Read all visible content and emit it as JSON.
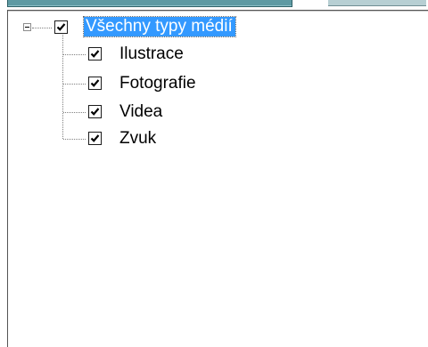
{
  "tree": {
    "root": {
      "label": "Všechny typy médií",
      "checked": true,
      "expanded": true
    },
    "children": [
      {
        "label": "Ilustrace",
        "checked": true
      },
      {
        "label": "Fotografie",
        "checked": true
      },
      {
        "label": "Videa",
        "checked": true
      },
      {
        "label": "Zvuk",
        "checked": true
      }
    ]
  },
  "colors": {
    "selection": "#3399ff",
    "tab": "#5e9aa3"
  },
  "icons": {
    "expander": "collapse-minus-icon",
    "checkbox": "checkmark-icon"
  }
}
